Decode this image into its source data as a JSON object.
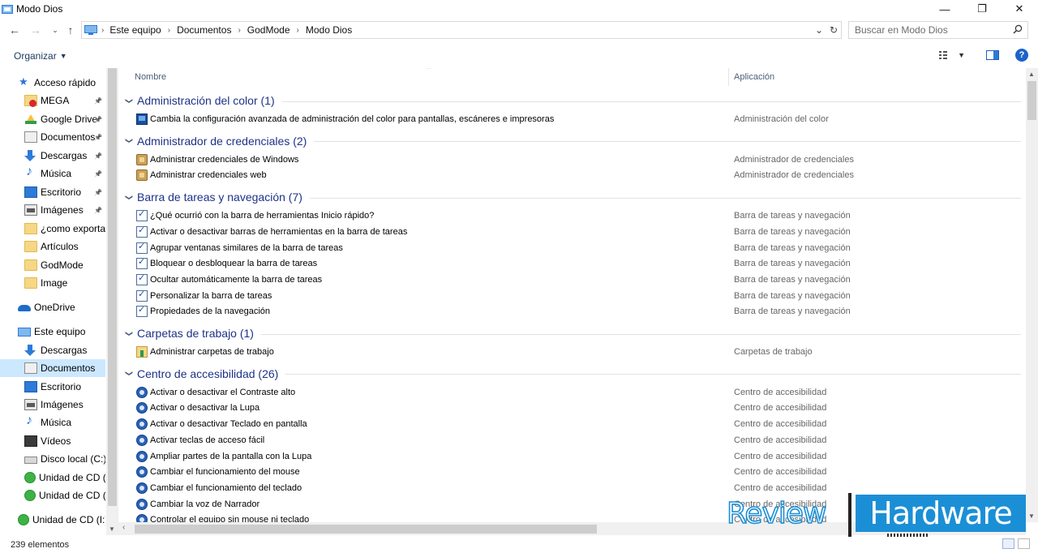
{
  "window": {
    "title": "Modo Dios",
    "controls": {
      "minimize": "—",
      "maximize": "❐",
      "close": "✕"
    }
  },
  "address": {
    "breadcrumbs": [
      "Este equipo",
      "Documentos",
      "GodMode",
      "Modo Dios"
    ],
    "search_placeholder": "Buscar en Modo Dios"
  },
  "toolbar": {
    "organize_label": "Organizar"
  },
  "nav": {
    "items": [
      {
        "label": "Acceso rápido",
        "icon": "star-icon",
        "pinned": false
      },
      {
        "label": "MEGA",
        "icon": "mega-folder-icon",
        "pinned": true
      },
      {
        "label": "Google Drive",
        "icon": "google-drive-icon",
        "pinned": true
      },
      {
        "label": "Documentos",
        "icon": "documents-icon",
        "pinned": true
      },
      {
        "label": "Descargas",
        "icon": "downloads-icon",
        "pinned": true
      },
      {
        "label": "Música",
        "icon": "music-icon",
        "pinned": true
      },
      {
        "label": "Escritorio",
        "icon": "desktop-icon",
        "pinned": true
      },
      {
        "label": "Imágenes",
        "icon": "images-icon",
        "pinned": true
      },
      {
        "label": "¿como exportar",
        "icon": "shortcut-folder-icon",
        "pinned": false
      },
      {
        "label": "Artículos",
        "icon": "folder-icon",
        "pinned": false
      },
      {
        "label": "GodMode",
        "icon": "folder-icon",
        "pinned": false
      },
      {
        "label": "Image",
        "icon": "folder-icon",
        "pinned": false
      },
      {
        "label": "OneDrive",
        "icon": "onedrive-icon",
        "pinned": false
      },
      {
        "label": "Este equipo",
        "icon": "this-pc-icon",
        "pinned": false
      },
      {
        "label": "Descargas",
        "icon": "downloads-icon",
        "pinned": false
      },
      {
        "label": "Documentos",
        "icon": "documents-icon",
        "pinned": false,
        "selected": true
      },
      {
        "label": "Escritorio",
        "icon": "desktop-icon",
        "pinned": false
      },
      {
        "label": "Imágenes",
        "icon": "images-icon",
        "pinned": false
      },
      {
        "label": "Música",
        "icon": "music-icon",
        "pinned": false
      },
      {
        "label": "Vídeos",
        "icon": "videos-icon",
        "pinned": false
      },
      {
        "label": "Disco local (C:)",
        "icon": "local-disk-icon",
        "pinned": false
      },
      {
        "label": "Unidad de CD (E",
        "icon": "cd-drive-icon",
        "pinned": false
      },
      {
        "label": "Unidad de CD (I:",
        "icon": "cd-drive-icon",
        "pinned": false
      },
      {
        "label": "Unidad de CD (I:)",
        "icon": "cd-drive-icon",
        "pinned": false
      }
    ]
  },
  "list": {
    "columns": {
      "name": "Nombre",
      "app": "Aplicación"
    },
    "groups": [
      {
        "title": "Administración del color (1)",
        "icon": "color-management-icon",
        "rows": [
          {
            "name": "Cambia la configuración avanzada de administración del color para pantallas, escáneres e impresoras",
            "app": "Administración del color"
          }
        ]
      },
      {
        "title": "Administrador de credenciales (2)",
        "icon": "credentials-icon",
        "rows": [
          {
            "name": "Administrar credenciales de Windows",
            "app": "Administrador de credenciales"
          },
          {
            "name": "Administrar credenciales web",
            "app": "Administrador de credenciales"
          }
        ]
      },
      {
        "title": "Barra de tareas y navegación (7)",
        "icon": "taskbar-icon",
        "rows": [
          {
            "name": "¿Qué ocurrió con la barra de herramientas Inicio rápido?",
            "app": "Barra de tareas y navegación"
          },
          {
            "name": "Activar o desactivar barras de herramientas en la barra de tareas",
            "app": "Barra de tareas y navegación"
          },
          {
            "name": "Agrupar ventanas similares de la barra de tareas",
            "app": "Barra de tareas y navegación"
          },
          {
            "name": "Bloquear o desbloquear la barra de tareas",
            "app": "Barra de tareas y navegación"
          },
          {
            "name": "Ocultar automáticamente la barra de tareas",
            "app": "Barra de tareas y navegación"
          },
          {
            "name": "Personalizar la barra de tareas",
            "app": "Barra de tareas y navegación"
          },
          {
            "name": "Propiedades de la navegación",
            "app": "Barra de tareas y navegación"
          }
        ]
      },
      {
        "title": "Carpetas de trabajo (1)",
        "icon": "work-folders-icon",
        "rows": [
          {
            "name": "Administrar carpetas de trabajo",
            "app": "Carpetas de trabajo"
          }
        ]
      },
      {
        "title": "Centro de accesibilidad (26)",
        "icon": "accessibility-icon",
        "rows": [
          {
            "name": "Activar o desactivar el Contraste alto",
            "app": "Centro de accesibilidad"
          },
          {
            "name": "Activar o desactivar la Lupa",
            "app": "Centro de accesibilidad"
          },
          {
            "name": "Activar o desactivar Teclado en pantalla",
            "app": "Centro de accesibilidad"
          },
          {
            "name": "Activar teclas de acceso fácil",
            "app": "Centro de accesibilidad"
          },
          {
            "name": "Ampliar partes de la pantalla con la Lupa",
            "app": "Centro de accesibilidad"
          },
          {
            "name": "Cambiar el funcionamiento del mouse",
            "app": "Centro de accesibilidad"
          },
          {
            "name": "Cambiar el funcionamiento del teclado",
            "app": "Centro de accesibilidad"
          },
          {
            "name": "Cambiar la voz de Narrador",
            "app": "Centro de accesibilidad"
          },
          {
            "name": "Controlar el equipo sin mouse ni teclado",
            "app": "Centro de accesibilidad"
          }
        ]
      }
    ]
  },
  "status": {
    "item_count": "239 elementos"
  },
  "watermark": {
    "left": "Review",
    "right": "Hardware"
  },
  "colors": {
    "group_title": "#1e3287",
    "selection": "#cce8ff",
    "watermark_blue": "#1b8fd6"
  }
}
